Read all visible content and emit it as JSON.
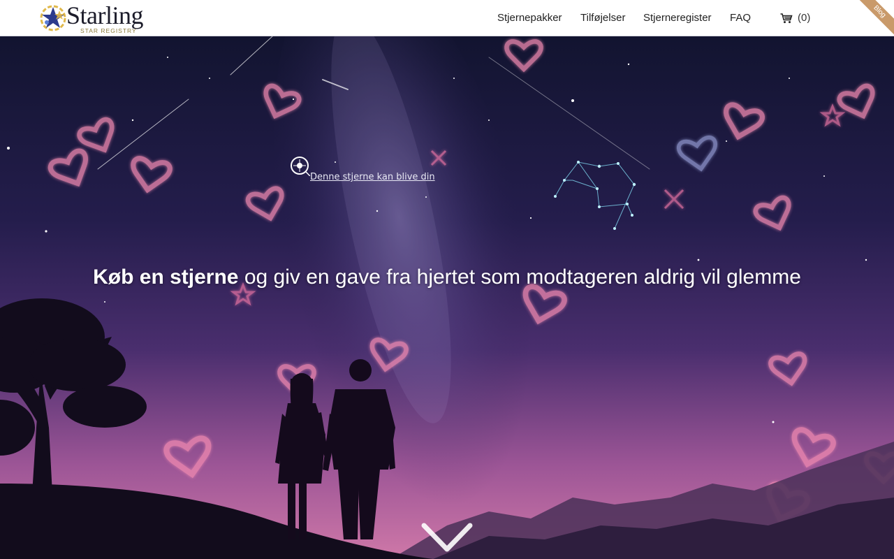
{
  "brand": {
    "name": "Starling",
    "tagline": "STAR REGISTRY"
  },
  "nav": {
    "items": [
      {
        "label": "Stjernepakker"
      },
      {
        "label": "Tilføjelser"
      },
      {
        "label": "Stjerneregister"
      },
      {
        "label": "FAQ"
      }
    ],
    "cart": {
      "icon": "cart-icon",
      "count": "(0)"
    }
  },
  "ribbon": {
    "label": "Blog"
  },
  "hero": {
    "star_label": "Denne stjerne kan blive din",
    "headline_bold": "Køb en stjerne",
    "headline_rest": " og giv en gave fra hjertet som modtageren aldrig vil glemme",
    "scroll_icon": "chevron-down-icon"
  },
  "colors": {
    "header_bg": "#ffffff",
    "nav_text": "#222222",
    "ribbon": "#c99a6a",
    "sky_top": "#141530",
    "sky_bottom": "#b05a9c",
    "heart_glow": "#f08ab0"
  }
}
